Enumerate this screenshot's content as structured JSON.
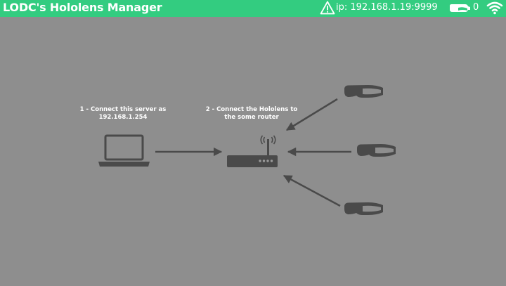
{
  "app": {
    "title": "LODC's Hololens Manager"
  },
  "status": {
    "ip_label": "ip: 192.168.1.19:9999",
    "headset_count": "0",
    "warning_icon": "warning-icon",
    "headset_icon": "headset-icon",
    "wifi_icon": "wifi-icon"
  },
  "steps": {
    "step1_line1": "1 - Connect this server as",
    "step1_line2": "192.168.1.254",
    "step2_line1": "2 - Connect the Hololens to",
    "step2_line2": "the some router"
  },
  "colors": {
    "topbar": "#33cc80",
    "background": "#8e8e8e",
    "diagram": "#4a4a4a"
  }
}
